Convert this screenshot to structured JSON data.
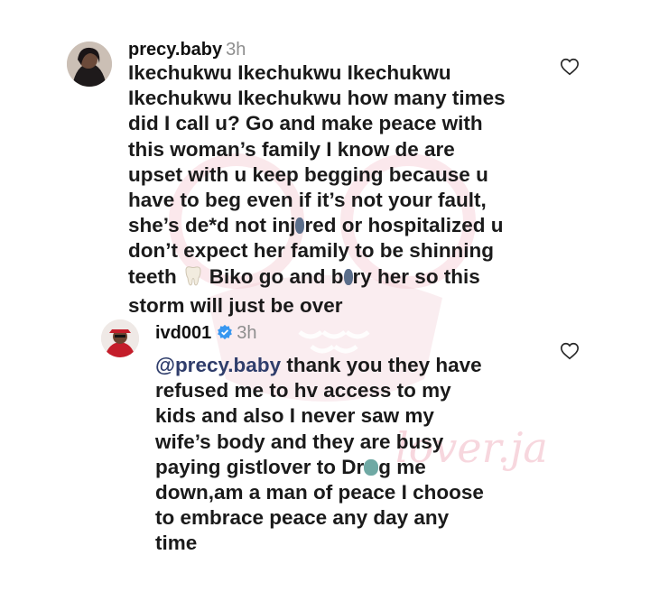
{
  "comments": [
    {
      "username": "precy.baby",
      "time": "3h",
      "lines": [
        "Ikechukwu Ikechukwu Ikechukwu",
        "Ikechukwu Ikechukwu how many times",
        "did I call u? Go and make peace with",
        "this woman’s family I know de are",
        "upset with u keep begging because u",
        "have to beg even if it’s not your fault,",
        "she’s de*d not inj",
        "red or hospitalized u",
        "don’t expect her family to be shinning",
        "teeth",
        "Biko go and b",
        "ry her so this",
        "storm will just be over"
      ],
      "avatar_icon": "user-avatar-photo",
      "like_icon": "heart-outline-icon"
    },
    {
      "username": "ivd001",
      "time": "3h",
      "verified_icon": "verified-badge-icon",
      "mention": "@precy.baby",
      "lines": [
        " thank you they have",
        "refused me to hv access to my",
        "kids and also I never saw my",
        "wife’s body and they are busy",
        "paying gistlover to Dr",
        "g me",
        "down,am a man of peace I choose",
        "to embrace peace any day any",
        "time"
      ],
      "avatar_icon": "user-avatar-photo",
      "like_icon": "heart-outline-icon"
    }
  ],
  "colors": {
    "text": "#1a1a1a",
    "muted": "#8e8e8e",
    "mention": "#2f3d6b",
    "verified": "#3897f0",
    "watermark": "#f3c6cf"
  }
}
